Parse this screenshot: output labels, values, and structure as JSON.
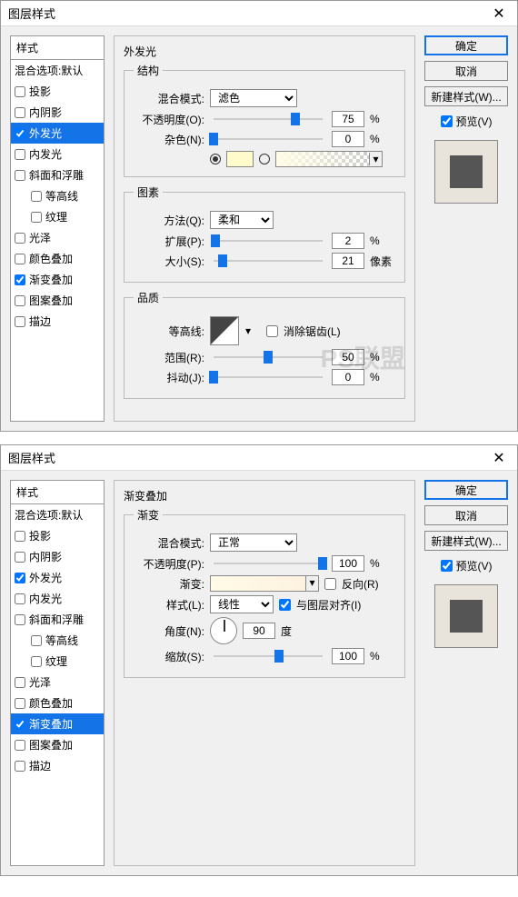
{
  "dialog1": {
    "title": "图层样式",
    "stylesHeader": "样式",
    "blendOptions": "混合选项:默认",
    "styles": [
      {
        "label": "投影",
        "checked": false
      },
      {
        "label": "内阴影",
        "checked": false
      },
      {
        "label": "外发光",
        "checked": true,
        "selected": true
      },
      {
        "label": "内发光",
        "checked": false
      },
      {
        "label": "斜面和浮雕",
        "checked": false
      },
      {
        "label": "等高线",
        "checked": false,
        "sub": true
      },
      {
        "label": "纹理",
        "checked": false,
        "sub": true
      },
      {
        "label": "光泽",
        "checked": false
      },
      {
        "label": "颜色叠加",
        "checked": false
      },
      {
        "label": "渐变叠加",
        "checked": true
      },
      {
        "label": "图案叠加",
        "checked": false
      },
      {
        "label": "描边",
        "checked": false
      }
    ],
    "sectionTitle": "外发光",
    "groups": {
      "structure": "结构",
      "elements": "图素",
      "quality": "品质"
    },
    "labels": {
      "blendMode": "混合模式:",
      "opacity": "不透明度(O):",
      "noise": "杂色(N):",
      "technique": "方法(Q):",
      "spread": "扩展(P):",
      "size": "大小(S):",
      "contour": "等高线:",
      "antiAlias": "消除锯齿(L)",
      "range": "范围(R):",
      "jitter": "抖动(J):"
    },
    "values": {
      "blendMode": "滤色",
      "opacity": "75",
      "noise": "0",
      "technique": "柔和",
      "spread": "2",
      "size": "21",
      "range": "50",
      "jitter": "0"
    },
    "units": {
      "percent": "%",
      "px": "像素"
    },
    "colors": {
      "solid": "#fffbca",
      "gradStart": "#fffde6"
    },
    "buttons": {
      "ok": "确定",
      "cancel": "取消",
      "newStyle": "新建样式(W)...",
      "preview": "预览(V)"
    }
  },
  "dialog2": {
    "title": "图层样式",
    "stylesHeader": "样式",
    "blendOptions": "混合选项:默认",
    "styles": [
      {
        "label": "投影",
        "checked": false
      },
      {
        "label": "内阴影",
        "checked": false
      },
      {
        "label": "外发光",
        "checked": true
      },
      {
        "label": "内发光",
        "checked": false
      },
      {
        "label": "斜面和浮雕",
        "checked": false
      },
      {
        "label": "等高线",
        "checked": false,
        "sub": true
      },
      {
        "label": "纹理",
        "checked": false,
        "sub": true
      },
      {
        "label": "光泽",
        "checked": false
      },
      {
        "label": "颜色叠加",
        "checked": false
      },
      {
        "label": "渐变叠加",
        "checked": true,
        "selected": true
      },
      {
        "label": "图案叠加",
        "checked": false
      },
      {
        "label": "描边",
        "checked": false
      }
    ],
    "sectionTitle": "渐变叠加",
    "groups": {
      "gradient": "渐变"
    },
    "labels": {
      "blendMode": "混合模式:",
      "opacity": "不透明度(P):",
      "gradient": "渐变:",
      "reverse": "反向(R)",
      "style": "样式(L):",
      "alignWithLayer": "与图层对齐(I)",
      "angle": "角度(N):",
      "degree": "度",
      "scale": "缩放(S):"
    },
    "values": {
      "blendMode": "正常",
      "opacity": "100",
      "style": "线性",
      "angle": "90",
      "scale": "100"
    },
    "units": {
      "percent": "%"
    },
    "buttons": {
      "ok": "确定",
      "cancel": "取消",
      "newStyle": "新建样式(W)...",
      "preview": "预览(V)"
    }
  }
}
